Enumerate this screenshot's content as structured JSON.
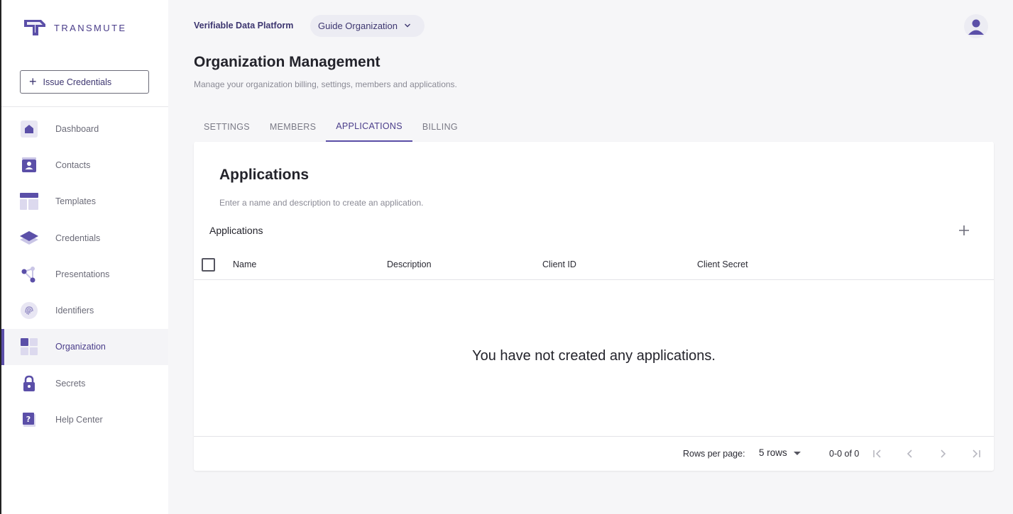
{
  "brand": {
    "name": "TRANSMUTE",
    "accent": "#5b4fa8"
  },
  "sidebar": {
    "issue_button": {
      "label": "Issue Credentials",
      "icon": "plus-icon"
    },
    "items": [
      {
        "label": "Dashboard",
        "icon": "home-icon"
      },
      {
        "label": "Contacts",
        "icon": "contact-card-icon"
      },
      {
        "label": "Templates",
        "icon": "template-icon"
      },
      {
        "label": "Credentials",
        "icon": "credential-layers-icon"
      },
      {
        "label": "Presentations",
        "icon": "presentation-nodes-icon"
      },
      {
        "label": "Identifiers",
        "icon": "fingerprint-icon"
      },
      {
        "label": "Organization",
        "icon": "organization-grid-icon",
        "active": true
      },
      {
        "label": "Secrets",
        "icon": "lock-icon"
      },
      {
        "label": "Help Center",
        "icon": "help-icon"
      }
    ]
  },
  "header": {
    "product": "Verifiable Data Platform",
    "org_select": "Guide Organization",
    "avatar_icon": "user-avatar-icon"
  },
  "page": {
    "title": "Organization Management",
    "subtitle": "Manage your organization billing, settings, members and applications."
  },
  "tabs": [
    {
      "label": "SETTINGS"
    },
    {
      "label": "MEMBERS"
    },
    {
      "label": "APPLICATIONS",
      "active": true
    },
    {
      "label": "BILLING"
    }
  ],
  "card": {
    "title": "Applications",
    "subtitle": "Enter a name and description to create an application.",
    "table_title": "Applications",
    "columns": [
      "Name",
      "Description",
      "Client ID",
      "Client Secret"
    ],
    "empty_message": "You have not created any applications.",
    "footer": {
      "rows_per_page_label": "Rows per page:",
      "rows_per_page_value": "5 rows",
      "range": "0-0 of 0"
    }
  }
}
